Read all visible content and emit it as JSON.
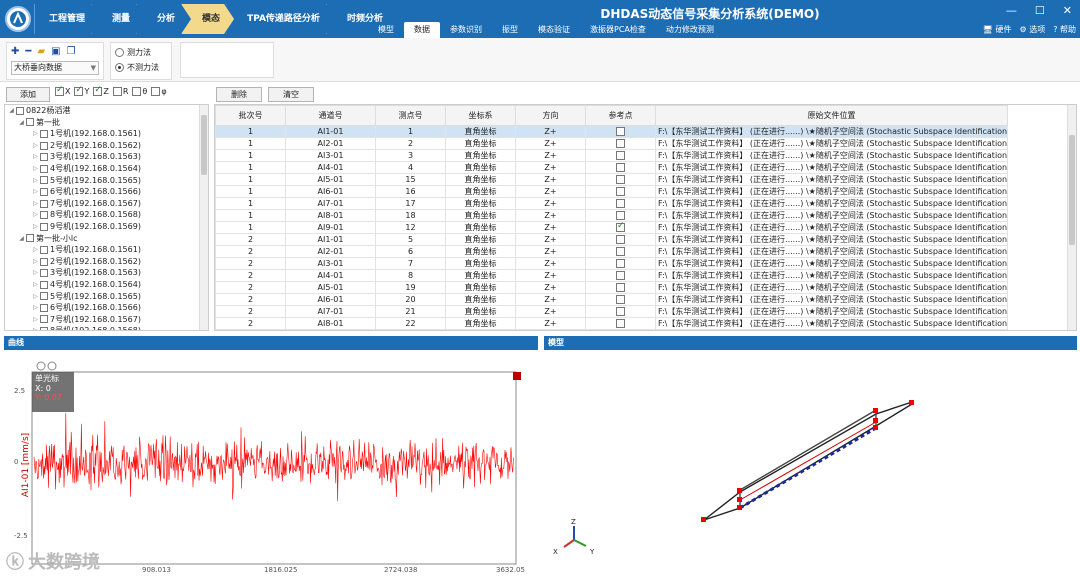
{
  "app": {
    "title": "DHDAS动态信号采集分析系统(DEMO)"
  },
  "crumbs": [
    "工程管理",
    "测量",
    "分析",
    "模态",
    "TPA传递路径分析",
    "时频分析"
  ],
  "active_crumb": 3,
  "ribbon_tabs": [
    "模型",
    "数据",
    "参数识别",
    "振型",
    "模态验证",
    "激振器PCA检查",
    "动力修改预测"
  ],
  "active_ribbon": 1,
  "right_tools": {
    "hardware": "硬件",
    "options": "选项",
    "help": "帮助"
  },
  "toolbar": {
    "select_value": "大桥垂向数据",
    "radio1": "测力法",
    "radio2": "不测力法"
  },
  "controls": {
    "add": "添加",
    "delete": "删除",
    "clear": "清空",
    "axes": [
      {
        "label": "X",
        "checked": true
      },
      {
        "label": "Y",
        "checked": true
      },
      {
        "label": "Z",
        "checked": true
      },
      {
        "label": "R",
        "checked": false
      },
      {
        "label": "θ",
        "checked": false
      },
      {
        "label": "φ",
        "checked": false
      }
    ]
  },
  "tree": {
    "root": "0822杨滔港",
    "groups": [
      {
        "name": "第一批",
        "items": [
          "1号机(192.168.0.1561)",
          "2号机(192.168.0.1562)",
          "3号机(192.168.0.1563)",
          "4号机(192.168.0.1564)",
          "5号机(192.168.0.1565)",
          "6号机(192.168.0.1566)",
          "7号机(192.168.0.1567)",
          "8号机(192.168.0.1568)",
          "9号机(192.168.0.1569)"
        ]
      },
      {
        "name": "第一批-小lc",
        "items": [
          "1号机(192.168.0.1561)",
          "2号机(192.168.0.1562)",
          "3号机(192.168.0.1563)",
          "4号机(192.168.0.1564)",
          "5号机(192.168.0.1565)",
          "6号机(192.168.0.1566)",
          "7号机(192.168.0.1567)",
          "8号机(192.168.0.1568)"
        ]
      }
    ]
  },
  "table": {
    "headers": [
      "批次号",
      "通道号",
      "测点号",
      "坐标系",
      "方向",
      "参考点",
      "原始文件位置"
    ],
    "path_text": "F:\\【东华测试工作资料】 (正在进行......) \\★随机子空间法 (Stochastic Subspace Identification)",
    "rows": [
      [
        "1",
        "AI1-01",
        "1",
        "直角坐标",
        "Z+",
        false
      ],
      [
        "1",
        "AI2-01",
        "2",
        "直角坐标",
        "Z+",
        false
      ],
      [
        "1",
        "AI3-01",
        "3",
        "直角坐标",
        "Z+",
        false
      ],
      [
        "1",
        "AI4-01",
        "4",
        "直角坐标",
        "Z+",
        false
      ],
      [
        "1",
        "AI5-01",
        "15",
        "直角坐标",
        "Z+",
        false
      ],
      [
        "1",
        "AI6-01",
        "16",
        "直角坐标",
        "Z+",
        false
      ],
      [
        "1",
        "AI7-01",
        "17",
        "直角坐标",
        "Z+",
        false
      ],
      [
        "1",
        "AI8-01",
        "18",
        "直角坐标",
        "Z+",
        false
      ],
      [
        "1",
        "AI9-01",
        "12",
        "直角坐标",
        "Z+",
        true
      ],
      [
        "2",
        "AI1-01",
        "5",
        "直角坐标",
        "Z+",
        false
      ],
      [
        "2",
        "AI2-01",
        "6",
        "直角坐标",
        "Z+",
        false
      ],
      [
        "2",
        "AI3-01",
        "7",
        "直角坐标",
        "Z+",
        false
      ],
      [
        "2",
        "AI4-01",
        "8",
        "直角坐标",
        "Z+",
        false
      ],
      [
        "2",
        "AI5-01",
        "19",
        "直角坐标",
        "Z+",
        false
      ],
      [
        "2",
        "AI6-01",
        "20",
        "直角坐标",
        "Z+",
        false
      ],
      [
        "2",
        "AI7-01",
        "21",
        "直角坐标",
        "Z+",
        false
      ],
      [
        "2",
        "AI8-01",
        "22",
        "直角坐标",
        "Z+",
        false
      ]
    ]
  },
  "curve_panel": {
    "title": "曲线",
    "cursor_title": "单光标",
    "cursor_x": "X: 0",
    "cursor_y": "Y: 0.07",
    "ylabel": "AI1-01 [mm/s]",
    "y_ticks": [
      "2.5",
      "0",
      "-2.5"
    ],
    "x_ticks": [
      "908.013",
      "1816.025",
      "2724.038",
      "3632.05"
    ]
  },
  "model_panel": {
    "title": "模型",
    "axis_x": "X",
    "axis_y": "Y",
    "axis_z": "Z"
  },
  "watermark": "大数跨境",
  "colors": {
    "brand": "#1d6db5",
    "active_crumb": "#f3d98c",
    "signal": "#ff0000",
    "selected_row": "#cfe3f5"
  }
}
